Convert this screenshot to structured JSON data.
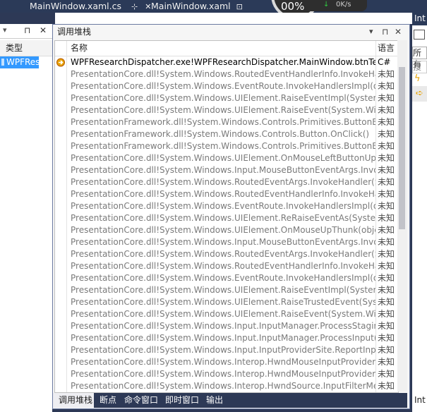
{
  "doc_tabs": [
    {
      "label": "MainWindow.xaml.cs",
      "pin": "⊹",
      "close": "✕"
    },
    {
      "label": "MainWindow.xaml",
      "pin": "⊡"
    }
  ],
  "perf_widget": {
    "percent": "00%",
    "rate": "0K/s"
  },
  "left_panel": {
    "pin": "⊓",
    "close": "✕",
    "column_header": "类型",
    "selected_row": "WPFResea"
  },
  "right_panel": {
    "title": "Int",
    "filter_text": "所有",
    "search_text": "搜",
    "footer_text": "Int"
  },
  "callstack_panel": {
    "title": "调用堆栈",
    "dropdown_icon": "▾",
    "pin_icon": "⊓",
    "close_icon": "✕",
    "columns": {
      "name": "名称",
      "language": "语言"
    },
    "rows": [
      {
        "name": "WPFResearchDispatcher.exe!WPFResearchDispatcher.MainWindow.btnTest_Click(",
        "lang": "C#",
        "current": true
      },
      {
        "name": "PresentationCore.dll!System.Windows.RoutedEventHandlerInfo.InvokeHandler(ob",
        "lang": "未知"
      },
      {
        "name": "PresentationCore.dll!System.Windows.EventRoute.InvokeHandlersImpl(object sou",
        "lang": "未知"
      },
      {
        "name": "PresentationCore.dll!System.Windows.UIElement.RaiseEventImpl(System.Window",
        "lang": "未知"
      },
      {
        "name": "PresentationCore.dll!System.Windows.UIElement.RaiseEvent(System.Windows.Rou",
        "lang": "未知"
      },
      {
        "name": "PresentationFramework.dll!System.Windows.Controls.Primitives.ButtonBase.OnCl",
        "lang": "未知"
      },
      {
        "name": "PresentationFramework.dll!System.Windows.Controls.Button.OnClick()",
        "lang": "未知"
      },
      {
        "name": "PresentationFramework.dll!System.Windows.Controls.Primitives.ButtonBase.OnM",
        "lang": "未知"
      },
      {
        "name": "PresentationCore.dll!System.Windows.UIElement.OnMouseLeftButtonUpThunk(ob",
        "lang": "未知"
      },
      {
        "name": "PresentationCore.dll!System.Windows.Input.MouseButtonEventArgs.InvokeEventH",
        "lang": "未知"
      },
      {
        "name": "PresentationCore.dll!System.Windows.RoutedEventArgs.InvokeHandler(System.De",
        "lang": "未知"
      },
      {
        "name": "PresentationCore.dll!System.Windows.RoutedEventHandlerInfo.InvokeHandler(ob",
        "lang": "未知"
      },
      {
        "name": "PresentationCore.dll!System.Windows.EventRoute.InvokeHandlersImpl(object sou",
        "lang": "未知"
      },
      {
        "name": "PresentationCore.dll!System.Windows.UIElement.ReRaiseEventAs(System.Window",
        "lang": "未知"
      },
      {
        "name": "PresentationCore.dll!System.Windows.UIElement.OnMouseUpThunk(object sende",
        "lang": "未知"
      },
      {
        "name": "PresentationCore.dll!System.Windows.Input.MouseButtonEventArgs.InvokeEventH",
        "lang": "未知"
      },
      {
        "name": "PresentationCore.dll!System.Windows.RoutedEventArgs.InvokeHandler(System.De",
        "lang": "未知"
      },
      {
        "name": "PresentationCore.dll!System.Windows.RoutedEventHandlerInfo.InvokeHandler(ob",
        "lang": "未知"
      },
      {
        "name": "PresentationCore.dll!System.Windows.EventRoute.InvokeHandlersImpl(object sou",
        "lang": "未知"
      },
      {
        "name": "PresentationCore.dll!System.Windows.UIElement.RaiseEventImpl(System.Window",
        "lang": "未知"
      },
      {
        "name": "PresentationCore.dll!System.Windows.UIElement.RaiseTrustedEvent(System.Wind",
        "lang": "未知"
      },
      {
        "name": "PresentationCore.dll!System.Windows.UIElement.RaiseEvent(System.Windows.Rou",
        "lang": "未知"
      },
      {
        "name": "PresentationCore.dll!System.Windows.Input.InputManager.ProcessStagingArea()",
        "lang": "未知"
      },
      {
        "name": "PresentationCore.dll!System.Windows.Input.InputManager.ProcessInput(System.W",
        "lang": "未知"
      },
      {
        "name": "PresentationCore.dll!System.Windows.Input.InputProviderSite.ReportInput(System",
        "lang": "未知"
      },
      {
        "name": "PresentationCore.dll!System.Windows.Interop.HwndMouseInputProvider.ReportIn",
        "lang": "未知"
      },
      {
        "name": "PresentationCore.dll!System.Windows.Interop.HwndMouseInputProvider.FilterMe",
        "lang": "未知"
      },
      {
        "name": "PresentationCore.dll!System.Windows.Interop.HwndSource.InputFilterMessage(Sy",
        "lang": "未知"
      }
    ]
  },
  "bottom_tabs": [
    "调用堆栈",
    "断点",
    "命令窗口",
    "即时窗口",
    "输出"
  ],
  "colors": {
    "accent": "#3399ff",
    "frame": "#2d3956",
    "current_frame_icon": "#e8a200"
  }
}
